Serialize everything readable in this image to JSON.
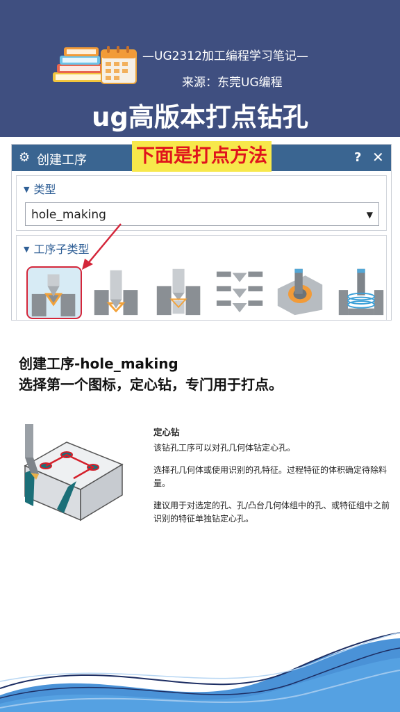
{
  "banner": {
    "series": "—UG2312加工编程学习笔记—",
    "source": "来源：东莞UG编程",
    "title": "ug高版本打点钻孔"
  },
  "dialog": {
    "title": "创建工序",
    "help_icon": "?",
    "close_icon": "✕",
    "highlight": "下面是打点方法",
    "type_group": {
      "label": "类型",
      "selected": "hole_making"
    },
    "subtype_group": {
      "label": "工序子类型",
      "icons": [
        "spot-drill-icon",
        "drill-icon",
        "counterbore-drill-icon",
        "multi-drill-icon",
        "hole-milling-icon",
        "thread-milling-icon"
      ]
    }
  },
  "caption": {
    "line1": "创建工序-hole_making",
    "line2": "选择第一个图标，定心钻，专门用于打点。"
  },
  "help": {
    "heading": "定心钻",
    "p1": "该钻孔工序可以对孔几何体钻定心孔。",
    "p2": "选择孔几何体或使用识别的孔特征。过程特征的体积确定待除料量。",
    "p3": "建议用于对选定的孔、孔/凸台几何体组中的孔、或特征组中之前识别的特征单独钻定心孔。"
  },
  "colors": {
    "banner": "#3f4f80",
    "titlebar": "#3a6591",
    "highlight_bg": "#f7e84b",
    "highlight_text": "#e0141c",
    "annotation": "#d4263a"
  }
}
